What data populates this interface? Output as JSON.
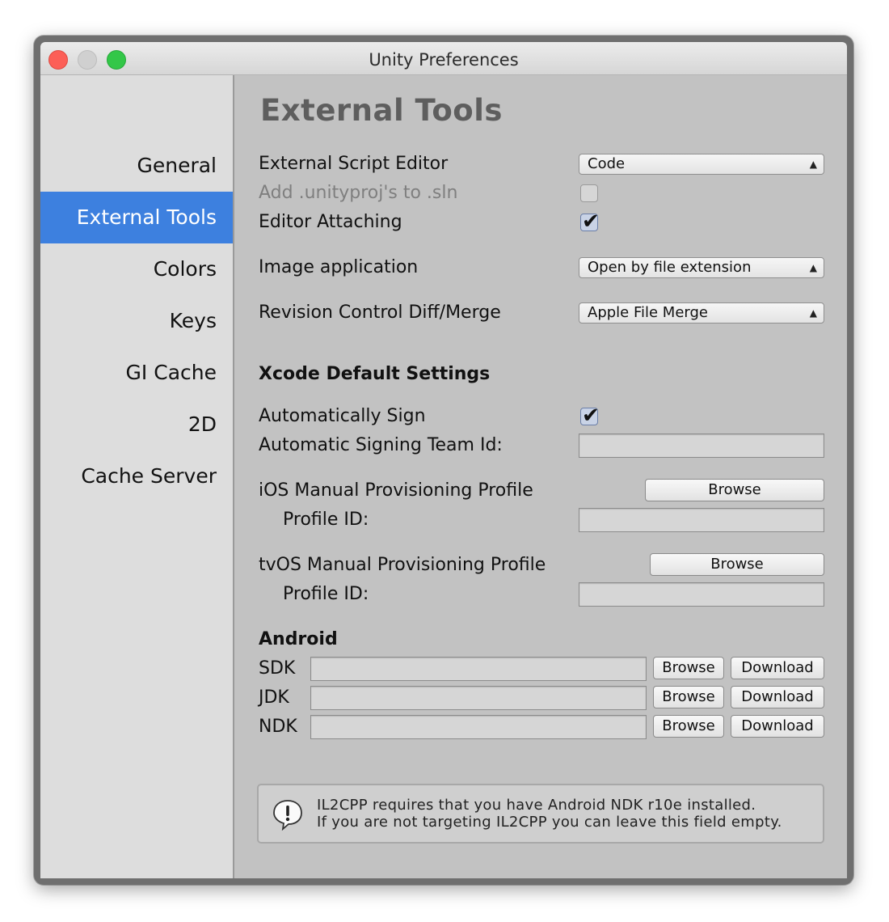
{
  "window": {
    "title": "Unity Preferences"
  },
  "sidebar": {
    "items": [
      {
        "label": "General",
        "active": false
      },
      {
        "label": "External Tools",
        "active": true
      },
      {
        "label": "Colors",
        "active": false
      },
      {
        "label": "Keys",
        "active": false
      },
      {
        "label": "GI Cache",
        "active": false
      },
      {
        "label": "2D",
        "active": false
      },
      {
        "label": "Cache Server",
        "active": false
      }
    ],
    "active_color": "#3d80df"
  },
  "content": {
    "heading": "External Tools",
    "external_script_editor": {
      "label": "External Script Editor",
      "value": "Code"
    },
    "add_unityproj": {
      "label": "Add .unityproj's to .sln",
      "checked": false,
      "disabled": true
    },
    "editor_attaching": {
      "label": "Editor Attaching",
      "checked": true
    },
    "image_application": {
      "label": "Image application",
      "value": "Open by file extension"
    },
    "revision_control": {
      "label": "Revision Control Diff/Merge",
      "value": "Apple File Merge"
    },
    "xcode": {
      "heading": "Xcode Default Settings",
      "auto_sign": {
        "label": "Automatically Sign",
        "checked": true
      },
      "team_id": {
        "label": "Automatic Signing Team Id:",
        "value": ""
      },
      "ios_profile": {
        "label": "iOS Manual Provisioning Profile",
        "browse": "Browse",
        "profile_id_label": "Profile ID:",
        "profile_id": ""
      },
      "tvos_profile": {
        "label": "tvOS Manual Provisioning Profile",
        "browse": "Browse",
        "profile_id_label": "Profile ID:",
        "profile_id": ""
      }
    },
    "android": {
      "heading": "Android",
      "rows": [
        {
          "label": "SDK",
          "value": "",
          "browse": "Browse",
          "download": "Download"
        },
        {
          "label": "JDK",
          "value": "",
          "browse": "Browse",
          "download": "Download"
        },
        {
          "label": "NDK",
          "value": "",
          "browse": "Browse",
          "download": "Download"
        }
      ]
    },
    "help": {
      "line1": "IL2CPP requires that you have Android NDK r10e installed.",
      "line2": "If you are not targeting IL2CPP you can leave this field empty."
    }
  }
}
